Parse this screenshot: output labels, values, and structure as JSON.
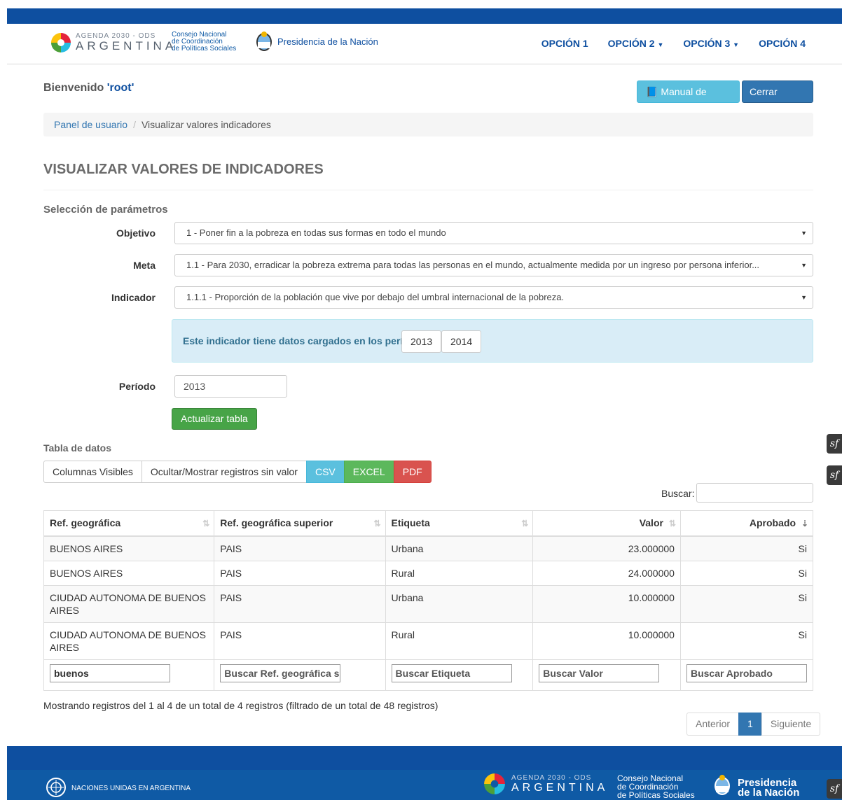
{
  "header": {
    "ods_small": "AGENDA 2030 - ODS",
    "ods_big": "ARGENTINA",
    "consejo_lines": [
      "Consejo Nacional",
      "de Coordinación",
      "de Políticas Sociales"
    ],
    "presidencia": "Presidencia de la Nación",
    "nav": [
      "OPCIÓN 1",
      "OPCIÓN 2",
      "OPCIÓN 3",
      "OPCIÓN 4"
    ],
    "brand_color": "#0e4fa0"
  },
  "user": {
    "welcome_prefix": "Bienvenido ",
    "username": "'root'",
    "manual_label": "Manual de usuario",
    "logout_label": "Cerrar sesión"
  },
  "breadcrumb": {
    "home": "Panel de usuario",
    "separator": "/",
    "current": "Visualizar valores indicadores"
  },
  "page": {
    "title": "VISUALIZAR VALORES DE INDICADORES",
    "params_section": "Selección de parámetros"
  },
  "form": {
    "objetivo_label": "Objetivo",
    "objetivo_value": "1 - Poner fin a la pobreza en todas sus formas en todo el mundo",
    "meta_label": "Meta",
    "meta_value": "1.1 - Para 2030, erradicar la pobreza extrema para todas las personas en el mundo, actualmente medida por un ingreso por persona inferior...",
    "indicador_label": "Indicador",
    "indicador_value": "1.1.1 - Proporción de la población que vive por debajo del umbral internacional de la pobreza.",
    "alert_text": "Este indicador tiene datos cargados en los períodos:",
    "periods": [
      "2013",
      "2014"
    ],
    "periodo_label": "Período",
    "periodo_value": "2013",
    "update_label": "Actualizar tabla"
  },
  "table_section": {
    "title": "Tabla de datos",
    "buttons": [
      "Columnas Visibles",
      "Ocultar/Mostrar registros sin valor",
      "CSV",
      "EXCEL",
      "PDF"
    ],
    "search_label": "Buscar:",
    "columns": [
      "Ref. geográfica",
      "Ref. geográfica superior",
      "Etiqueta",
      "Valor",
      "Aprobado"
    ],
    "rows": [
      [
        "BUENOS AIRES",
        "PAIS",
        "Urbana",
        "23.000000",
        "Si"
      ],
      [
        "BUENOS AIRES",
        "PAIS",
        "Rural",
        "24.000000",
        "Si"
      ],
      [
        "CIUDAD AUTONOMA DE BUENOS AIRES",
        "PAIS",
        "Urbana",
        "10.000000",
        "Si"
      ],
      [
        "CIUDAD AUTONOMA DE BUENOS AIRES",
        "PAIS",
        "Rural",
        "10.000000",
        "Si"
      ]
    ],
    "filters": {
      "ref_value": "buenos",
      "ref_sup_placeholder": "Buscar Ref. geográfica  supe",
      "etiqueta_placeholder": "Buscar Etiqueta",
      "valor_placeholder": "Buscar Valor",
      "aprobado_placeholder": "Buscar Aprobado"
    },
    "info": "Mostrando registros del 1 al 4 de un total de 4 registros (filtrado de un total de 48 registros)",
    "pagination": {
      "prev": "Anterior",
      "current": "1",
      "next": "Siguiente"
    }
  },
  "footer": {
    "un_text": "NACIONES UNIDAS EN ARGENTINA",
    "ods_small": "AGENDA 2030 - ODS",
    "ods_big": "ARGENTINA",
    "consejo_lines": [
      "Consejo Nacional",
      "de Coordinación",
      "de Políticas Sociales"
    ],
    "presidencia_lines": [
      "Presidencia",
      "de la Nación"
    ]
  },
  "side_badges": [
    "sf",
    "sf",
    "sf"
  ]
}
